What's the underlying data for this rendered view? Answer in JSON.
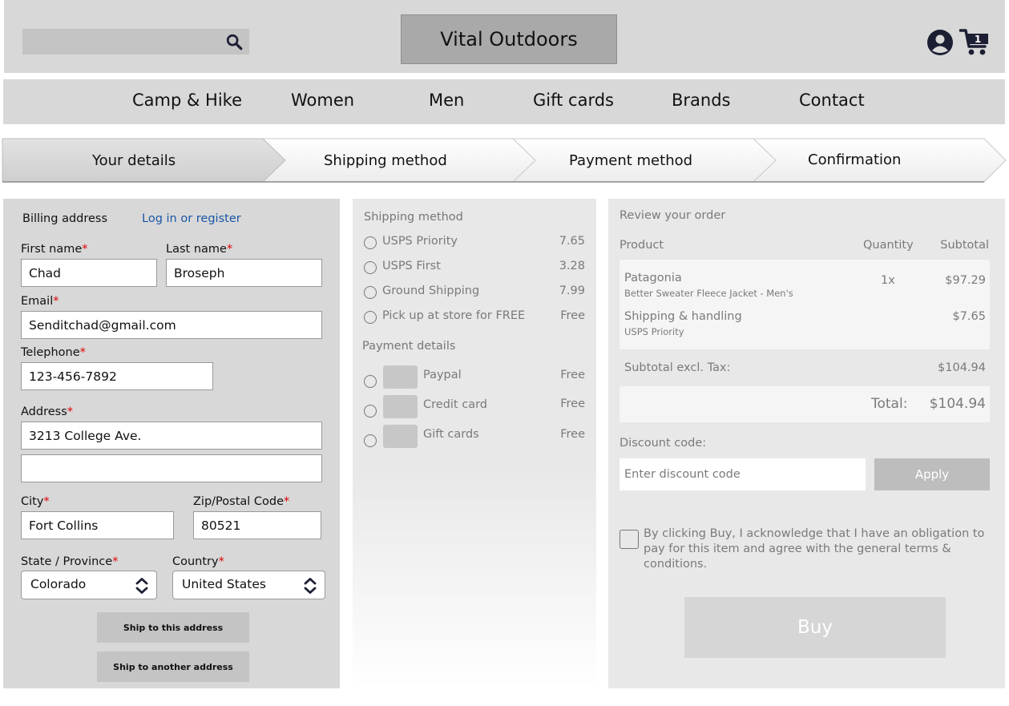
{
  "header": {
    "search_placeholder": "",
    "brand": "Vital Outdoors",
    "cart_count": "1"
  },
  "nav": {
    "items": [
      "Camp & Hike",
      "Women",
      "Men",
      "Gift cards",
      "Brands",
      "Contact"
    ]
  },
  "steps": {
    "items": [
      "Your details",
      "Shipping method",
      "Payment method",
      "Confirmation"
    ],
    "active_index": 0
  },
  "billing": {
    "title": "Billing address",
    "login_link": "Log in or register",
    "required_mark": "*",
    "first_name": {
      "label": "First name",
      "value": "Chad"
    },
    "last_name": {
      "label": "Last name",
      "value": "Broseph"
    },
    "email": {
      "label": "Email",
      "value": "Senditchad@gmail.com"
    },
    "telephone": {
      "label": "Telephone",
      "value": "123-456-7892"
    },
    "address": {
      "label": "Address",
      "value": "3213 College Ave.",
      "line2": ""
    },
    "city": {
      "label": "City",
      "value": "Fort Collins"
    },
    "zip": {
      "label": "Zip/Postal Code",
      "value": "80521"
    },
    "state": {
      "label": "State / Province",
      "value": "Colorado"
    },
    "country": {
      "label": "Country",
      "value": "United States"
    },
    "ship_here": "Ship to this address",
    "ship_other": "Ship to another address"
  },
  "shipping": {
    "title": "Shipping method",
    "options": [
      {
        "label": "USPS Priority",
        "price": "7.65"
      },
      {
        "label": "USPS First",
        "price": "3.28"
      },
      {
        "label": "Ground Shipping",
        "price": "7.99"
      },
      {
        "label": "Pick up at store for FREE",
        "price": "Free"
      }
    ],
    "payment_title": "Payment details",
    "payments": [
      {
        "label": "Paypal",
        "price": "Free"
      },
      {
        "label": "Credit card",
        "price": "Free"
      },
      {
        "label": "Gift cards",
        "price": "Free"
      }
    ]
  },
  "review": {
    "title": "Review your order",
    "col_product": "Product",
    "col_quantity": "Quantity",
    "col_subtotal": "Subtotal",
    "item_name": "Patagonia",
    "item_desc": "Better Sweater Fleece Jacket - Men's",
    "item_qty": "1x",
    "item_price": "$97.29",
    "ship_name": "Shipping & handling",
    "ship_desc": "USPS Priority",
    "ship_price": "$7.65",
    "subtotal_label": "Subtotal excl. Tax:",
    "subtotal_value": "$104.94",
    "total_label": "Total:",
    "total_value": "$104.94",
    "discount_label": "Discount code:",
    "discount_placeholder": "Enter discount code",
    "apply": "Apply",
    "terms": "By clicking Buy, I acknowledge that I have an obligation to pay for this item and agree with the general terms & conditions.",
    "buy": "Buy"
  },
  "colors": {
    "panel_gray": "#d8d8d8",
    "light_gray": "#e8e8e8",
    "link_blue": "#1a56a6",
    "required_red": "#e00000",
    "icon_navy": "#1c1f33"
  }
}
